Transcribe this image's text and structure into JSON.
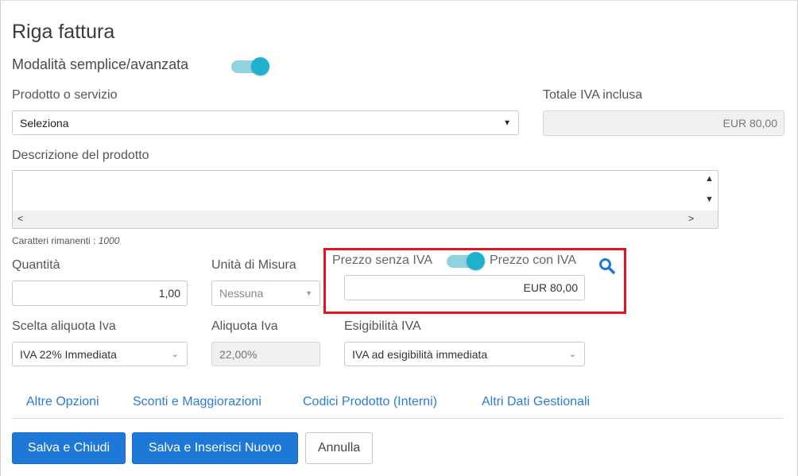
{
  "dialog": {
    "title": "Riga fattura",
    "mode_toggle_label": "Modalità semplice/avanzata"
  },
  "product": {
    "label": "Prodotto o servizio",
    "selected": "Seleziona"
  },
  "total": {
    "label": "Totale IVA inclusa",
    "value": "EUR 80,00"
  },
  "description": {
    "label": "Descrizione del prodotto",
    "remaining_label": "Caratteri rimanenti : ",
    "remaining_value": "1000"
  },
  "quantity": {
    "label": "Quantità",
    "value": "1,00"
  },
  "unit": {
    "label": "Unità di Misura",
    "selected": "Nessuna"
  },
  "price": {
    "label_without_vat": "Prezzo senza IVA",
    "label_with_vat": "Prezzo con IVA",
    "value": "EUR 80,00"
  },
  "vat_choice": {
    "label": "Scelta aliquota Iva",
    "selected": "IVA 22% Immediata"
  },
  "vat_rate": {
    "label": "Aliquota Iva",
    "value": "22,00%"
  },
  "vat_collectability": {
    "label": "Esigibilità IVA",
    "selected": "IVA ad esigibilità immediata"
  },
  "tabs": [
    {
      "label": "Altre Opzioni"
    },
    {
      "label": "Sconti e Maggiorazioni"
    },
    {
      "label": "Codici Prodotto (Interni)"
    },
    {
      "label": "Altri Dati Gestionali"
    }
  ],
  "buttons": {
    "save_close": "Salva e Chiudi",
    "save_new": "Salva e Inserisci Nuovo",
    "cancel": "Annulla"
  },
  "colors": {
    "accent": "#1fb2cf",
    "primary_button": "#1e78d8",
    "highlight_box": "#e0161e",
    "link": "#2b7bd6"
  },
  "icons": {
    "search": "search-icon",
    "dropdown": "caret-down-icon",
    "scroll": "scroll-arrow-icons"
  }
}
